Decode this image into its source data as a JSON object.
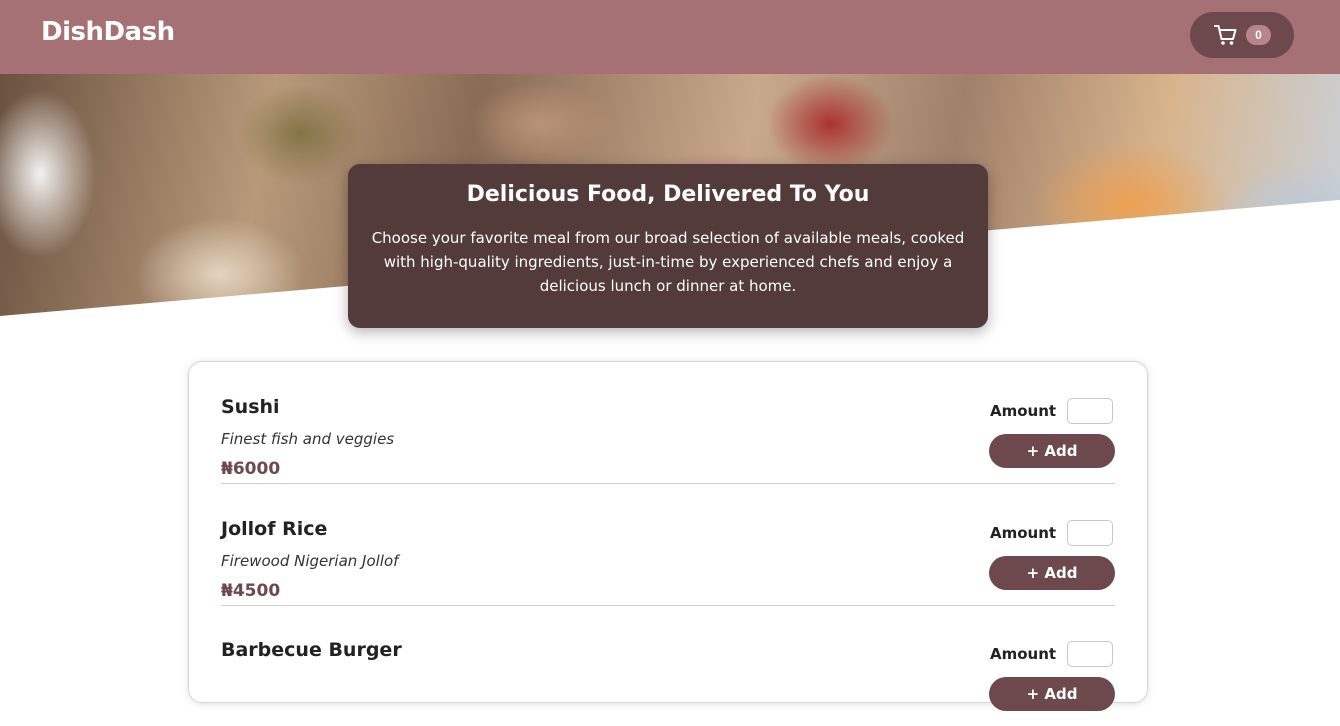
{
  "header": {
    "logo": "DishDash",
    "cart_count": "0"
  },
  "hero": {
    "title": "Delicious Food, Delivered To You",
    "text": "Choose your favorite meal from our broad selection of available meals, cooked with high-quality ingredients, just-in-time by experienced chefs and enjoy a delicious lunch or dinner at home."
  },
  "meals": [
    {
      "name": "Sushi",
      "description": "Finest fish and veggies",
      "price": "₦6000",
      "amount_label": "Amount",
      "add_label": "+ Add"
    },
    {
      "name": "Jollof Rice",
      "description": "Firewood Nigerian Jollof",
      "price": "₦4500",
      "amount_label": "Amount",
      "add_label": "+ Add"
    },
    {
      "name": "Barbecue Burger",
      "description": "",
      "price": "",
      "amount_label": "Amount",
      "add_label": "+ Add"
    }
  ],
  "icons": {
    "cart": "shopping-cart-icon"
  },
  "colors": {
    "header_bg": "#a57174",
    "accent": "#6d494e",
    "hero_card_bg": "#533a3b",
    "badge_bg": "#b7858a"
  }
}
